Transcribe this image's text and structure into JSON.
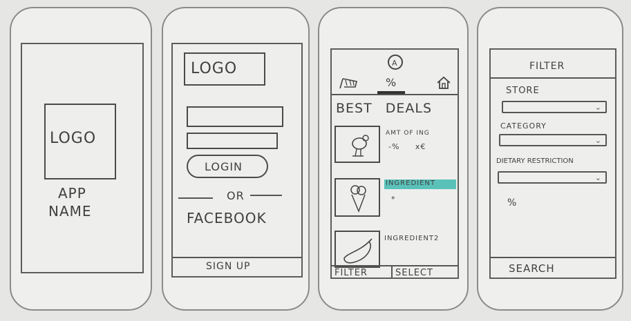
{
  "screens": {
    "splash": {
      "logo": "LOGO",
      "app_name_line1": "APP",
      "app_name_line2": "NAME"
    },
    "login": {
      "logo": "LOGO",
      "login_button": "LOGIN",
      "or_text": "OR",
      "facebook": "FACEBOOK",
      "signup": "SIGN UP"
    },
    "deals": {
      "heading": "BEST DEALS",
      "tab_percent": "%",
      "items": [
        {
          "name": "AMT OF ING",
          "prices": "-% x€",
          "icon": "bird-icon"
        },
        {
          "name": "INGREDIENT",
          "prices": "*",
          "icon": "icecream-icon"
        },
        {
          "name": "INGREDIENT2",
          "prices": "",
          "icon": "eggplant-icon"
        }
      ],
      "filter_button": "FILTER",
      "select_button": "SELECT",
      "highlight_color": "#3fb8b0"
    },
    "filter": {
      "title": "FILTER",
      "store_label": "STORE",
      "category_label": "CATEGORY",
      "dietary_label": "DIETARY RESTRICTION",
      "percent": "%",
      "search_button": "SEARCH"
    }
  }
}
